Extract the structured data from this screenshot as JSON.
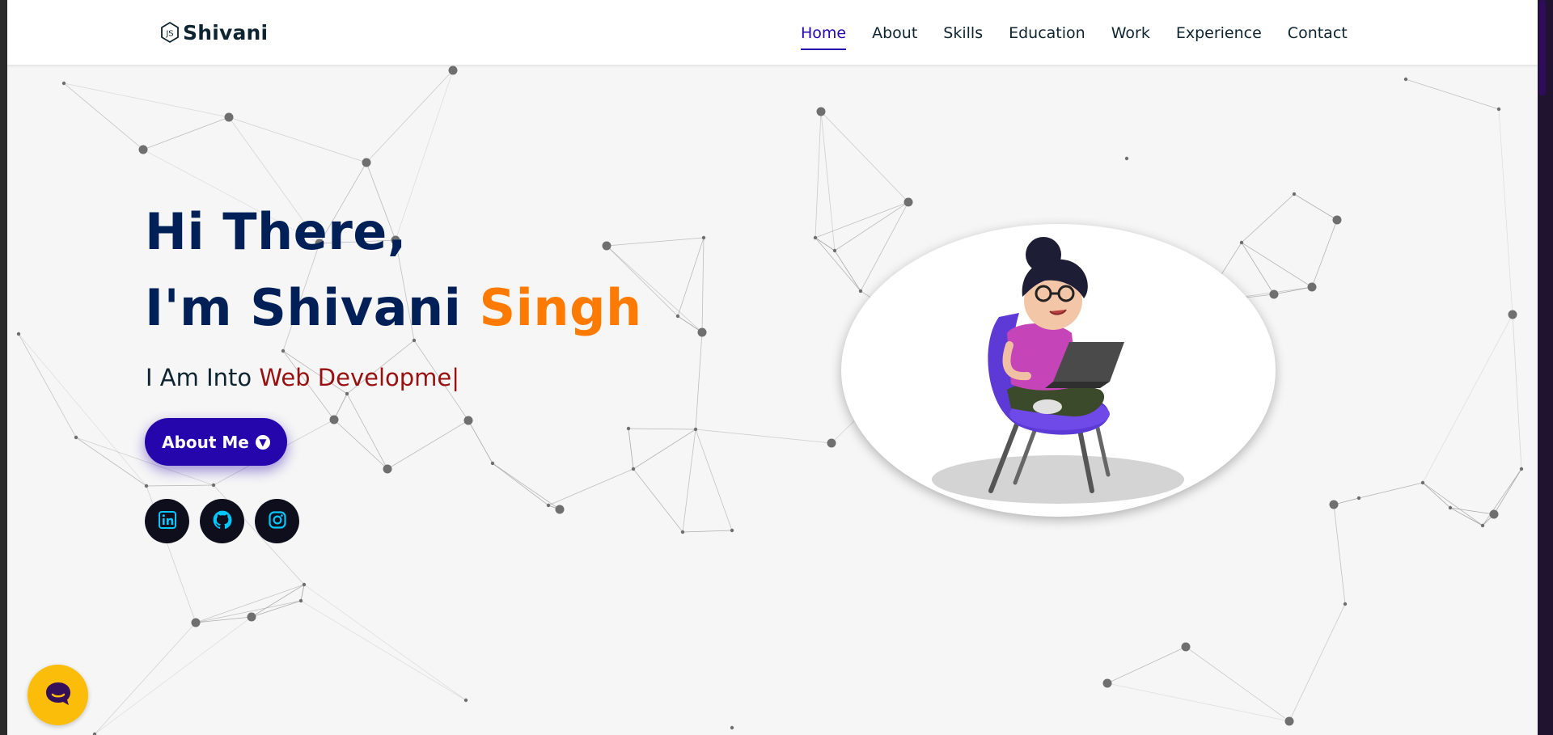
{
  "brand": {
    "name": "Shivani",
    "icon": "nodejs-hexagon-icon"
  },
  "nav": {
    "items": [
      {
        "label": "Home",
        "active": true
      },
      {
        "label": "About"
      },
      {
        "label": "Skills"
      },
      {
        "label": "Education"
      },
      {
        "label": "Work"
      },
      {
        "label": "Experience"
      },
      {
        "label": "Contact"
      }
    ]
  },
  "hero": {
    "greeting": "Hi There,",
    "name_prefix": "I'm Shivani",
    "name_accent": "Singh",
    "into_prefix": "I Am Into",
    "typed_text": "Web Developme|",
    "about_button": "About Me",
    "illustration": "girl-working-on-laptop-illustration"
  },
  "social": [
    {
      "name": "linkedin",
      "icon": "linkedin-icon"
    },
    {
      "name": "github",
      "icon": "github-icon"
    },
    {
      "name": "instagram",
      "icon": "instagram-icon"
    }
  ],
  "chat": {
    "icon": "chat-bubble-icon"
  },
  "colors": {
    "primary": "#2506ad",
    "heading": "#002057",
    "accent": "#ff7a00",
    "typed": "#991010",
    "chat": "#fbbd0a",
    "social_bg": "#0e0e1c",
    "social_icon": "#00c8ff"
  }
}
